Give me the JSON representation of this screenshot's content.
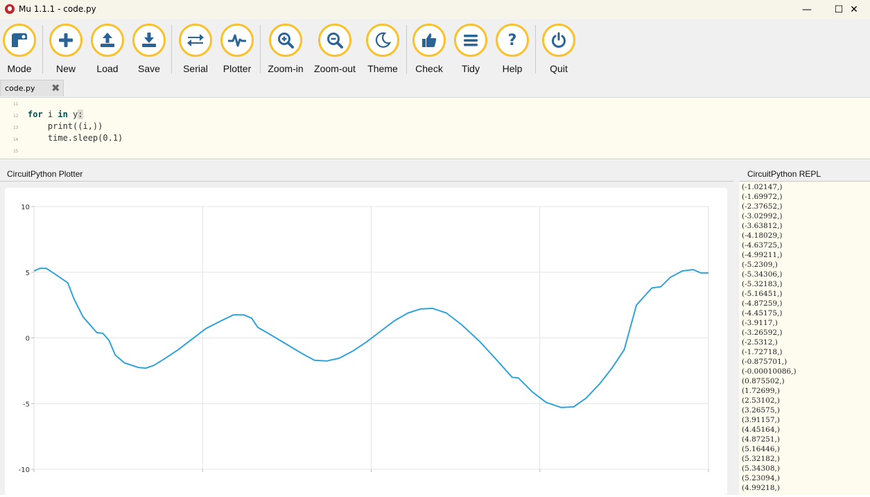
{
  "window": {
    "title": "Mu 1.1.1 - code.py"
  },
  "window_controls": {
    "minimize": "—",
    "maximize": "☐",
    "close": "✕"
  },
  "toolbar": {
    "buttons": [
      {
        "id": "mode",
        "label": "Mode",
        "icon": "mode-icon"
      },
      {
        "id": "new",
        "label": "New",
        "icon": "plus-icon"
      },
      {
        "id": "load",
        "label": "Load",
        "icon": "upload-icon"
      },
      {
        "id": "save",
        "label": "Save",
        "icon": "download-icon"
      },
      {
        "id": "serial",
        "label": "Serial",
        "icon": "arrows-icon"
      },
      {
        "id": "plotter",
        "label": "Plotter",
        "icon": "pulse-icon"
      },
      {
        "id": "zoom-in",
        "label": "Zoom-in",
        "icon": "zoom-in-icon"
      },
      {
        "id": "zoom-out",
        "label": "Zoom-out",
        "icon": "zoom-out-icon"
      },
      {
        "id": "theme",
        "label": "Theme",
        "icon": "moon-icon"
      },
      {
        "id": "check",
        "label": "Check",
        "icon": "thumbs-up-icon"
      },
      {
        "id": "tidy",
        "label": "Tidy",
        "icon": "lines-icon"
      },
      {
        "id": "help",
        "label": "Help",
        "icon": "question-icon"
      },
      {
        "id": "quit",
        "label": "Quit",
        "icon": "power-icon"
      }
    ],
    "accent": "#f9c12c",
    "icon_color": "#2a6496"
  },
  "tabs": [
    {
      "label": "code.py",
      "close_icon": "close-icon"
    }
  ],
  "editor": {
    "lines": [
      {
        "num": "11",
        "text": ""
      },
      {
        "num": "12",
        "kw1": "for",
        "mid": " i ",
        "kw2": "in",
        "rest": " y",
        "cursor": ":"
      },
      {
        "num": "13",
        "text": "    print((i,))"
      },
      {
        "num": "14",
        "text": "    time.sleep(0.1)"
      },
      {
        "num": "15",
        "text": ""
      }
    ]
  },
  "plotter": {
    "title": "CircuitPython Plotter",
    "y_ticks": [
      "10",
      "5",
      "0",
      "-5",
      "-10"
    ]
  },
  "chart_data": {
    "type": "line",
    "title": "",
    "xlabel": "",
    "ylabel": "",
    "ylim": [
      -10,
      10
    ],
    "grid": true,
    "series": [
      {
        "color": "#2ea3dc",
        "values": [
          5.1,
          5.3,
          5.3,
          5.0,
          4.2,
          3.0,
          1.6,
          0.4,
          0.35,
          -0.2,
          -1.3,
          -1.9,
          -2.25,
          -2.3,
          -2.1,
          -1.6,
          -0.9,
          -0.1,
          0.7,
          1.3,
          1.75,
          1.75,
          1.5,
          0.8,
          0.2,
          -0.5,
          -1.2,
          -1.7,
          -1.75,
          -1.55,
          -1.0,
          -0.3,
          0.5,
          1.3,
          1.9,
          2.2,
          2.25,
          1.9,
          1.0,
          -0.3,
          -1.7,
          -3.0,
          -3.05,
          -4.1,
          -4.9,
          -5.3,
          -5.25,
          -4.6,
          -3.5,
          -2.3,
          -0.9,
          2.5,
          3.8,
          3.9,
          4.6,
          5.1,
          5.2,
          4.95,
          4.95
        ],
        "x": [
          0,
          0.4,
          0.8,
          1.2,
          2.2,
          2.6,
          3.2,
          4.1,
          4.5,
          4.9,
          5.3,
          5.9,
          6.8,
          7.3,
          7.8,
          8.5,
          9.4,
          10.3,
          11.2,
          12.2,
          13.0,
          13.7,
          14.2,
          14.6,
          15.5,
          16.5,
          17.5,
          18.3,
          19.1,
          19.9,
          20.8,
          21.7,
          22.6,
          23.5,
          24.4,
          25.2,
          26.0,
          26.9,
          27.9,
          29.1,
          30.2,
          31.2,
          31.6,
          32.5,
          33.4,
          34.4,
          35.2,
          36.0,
          36.9,
          37.7,
          38.5,
          39.3,
          40.3,
          40.9,
          41.5,
          42.3,
          43.0,
          43.5,
          44.0
        ]
      }
    ],
    "xlim": [
      0,
      44.0
    ]
  },
  "repl": {
    "title": "CircuitPython REPL",
    "lines": [
      "(-1.02147,)",
      "(-1.69972,)",
      "(-2.37652,)",
      "(-3.02992,)",
      "(-3.63812,)",
      "(-4.18029,)",
      "(-4.63725,)",
      "(-4.99211,)",
      "(-5.2309,)",
      "(-5.34306,)",
      "(-5.32183,)",
      "(-5.16451,)",
      "(-4.87259,)",
      "(-4.45175,)",
      "(-3.9117,)",
      "(-3.26592,)",
      "(-2.5312,)",
      "(-1.72718,)",
      "(-0.875701,)",
      "(-0.00010086,)",
      "(0.875502,)",
      "(1.72699,)",
      "(2.53102,)",
      "(3.26575,)",
      "(3.91157,)",
      "(4.45164,)",
      "(4.87251,)",
      "(5.16446,)",
      "(5.32182,)",
      "(5.34308,)",
      "(5.23094,)",
      "(4.99218,)"
    ]
  }
}
